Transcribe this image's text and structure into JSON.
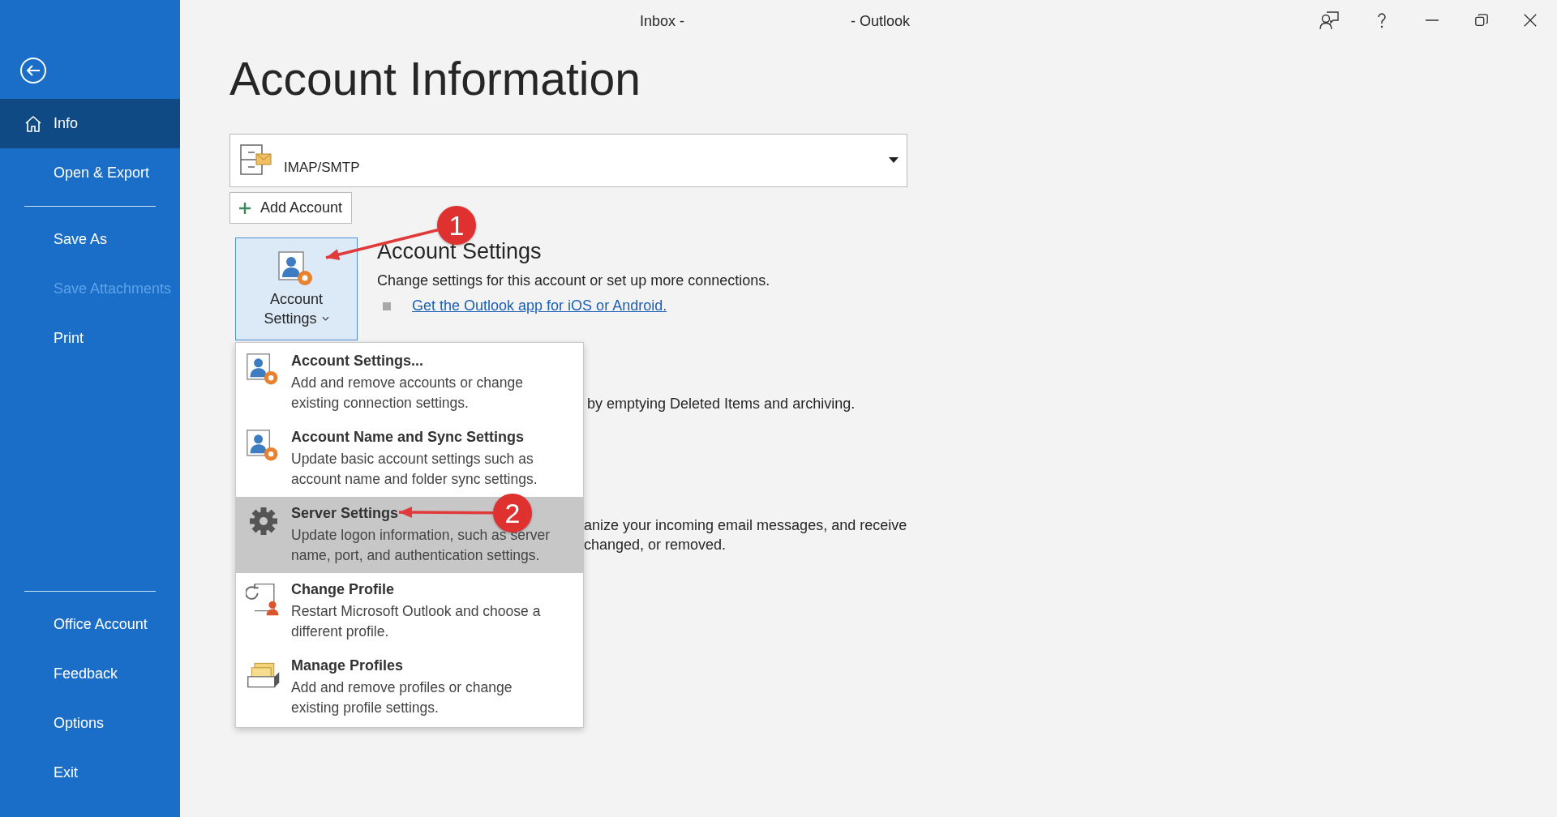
{
  "window": {
    "title_left": "Inbox -",
    "title_right": "- Outlook"
  },
  "sidebar": {
    "top_items": [
      {
        "kind": "item",
        "label": "Info",
        "selected": true,
        "disabled": false
      },
      {
        "kind": "item",
        "label": "Open & Export",
        "selected": false,
        "disabled": false
      },
      {
        "kind": "divider"
      },
      {
        "kind": "item",
        "label": "Save As",
        "selected": false,
        "disabled": false
      },
      {
        "kind": "item",
        "label": "Save Attachments",
        "selected": false,
        "disabled": true
      },
      {
        "kind": "item",
        "label": "Print",
        "selected": false,
        "disabled": false
      }
    ],
    "bottom_items": [
      {
        "kind": "divider"
      },
      {
        "kind": "item",
        "label": "Office Account",
        "selected": false,
        "disabled": false
      },
      {
        "kind": "item",
        "label": "Feedback",
        "selected": false,
        "disabled": false
      },
      {
        "kind": "item",
        "label": "Options",
        "selected": false,
        "disabled": false
      },
      {
        "kind": "item",
        "label": "Exit",
        "selected": false,
        "disabled": false
      }
    ]
  },
  "heading": "Account Information",
  "account_selector": {
    "value": "IMAP/SMTP"
  },
  "add_account_button": {
    "label": "Add Account"
  },
  "account_settings_button": {
    "label_line_1": "Account",
    "label_line_2": "Settings",
    "expanded": true
  },
  "section": {
    "title": "Account Settings",
    "description": "Change settings for this account or set up more connections.",
    "link": "Get the Outlook app for iOS or Android."
  },
  "partial_texts": [
    [
      "by emptying Deleted Items and archiving."
    ],
    [
      "anize your incoming email messages, and receive",
      "changed, or removed."
    ]
  ],
  "menu": {
    "items": [
      {
        "kind": "person-gear",
        "title": "Account Settings...",
        "description": "Add and remove accounts or change existing connection settings.",
        "selected": false
      },
      {
        "kind": "person-gear",
        "title": "Account Name and Sync Settings",
        "description": "Update basic account settings such as account name and folder sync settings.",
        "selected": false
      },
      {
        "kind": "gear",
        "title": "Server Settings",
        "description": "Update logon information, such as server name, port, and authentication settings.",
        "selected": true
      },
      {
        "kind": "profile-change",
        "title": "Change Profile",
        "description": "Restart Microsoft Outlook and choose a different profile.",
        "selected": false
      },
      {
        "kind": "profiles-box",
        "title": "Manage Profiles",
        "description": "Add and remove profiles or change existing profile settings.",
        "selected": false
      }
    ]
  },
  "annotations": [
    {
      "number": "1"
    },
    {
      "number": "2"
    }
  ]
}
